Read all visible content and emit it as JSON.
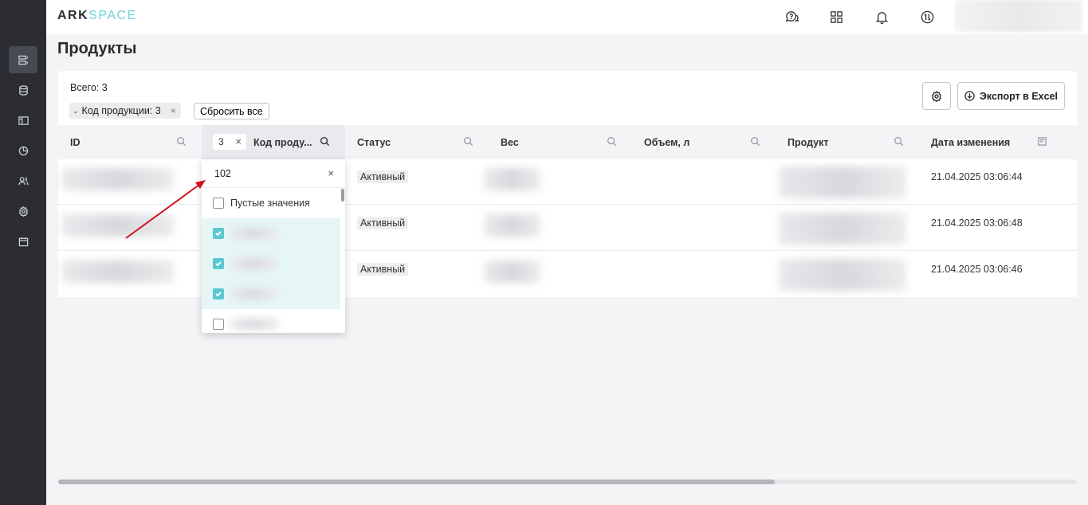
{
  "app": {
    "logo_ark": "ARK",
    "logo_space": "SPACE"
  },
  "sidebar": {
    "items": [
      {
        "icon": "products-icon",
        "active": true
      },
      {
        "icon": "database-icon",
        "active": false
      },
      {
        "icon": "layout-icon",
        "active": false
      },
      {
        "icon": "chart-icon",
        "active": false
      },
      {
        "icon": "users-icon",
        "active": false
      },
      {
        "icon": "gear-icon",
        "active": false
      },
      {
        "icon": "calendar-icon",
        "active": false
      }
    ]
  },
  "header": {
    "icons": [
      "support-chat-icon",
      "apps-grid-icon",
      "bell-icon",
      "sync-icon"
    ]
  },
  "page": {
    "title": "Продукты"
  },
  "toolbar": {
    "total": "Всего: 3",
    "filter_chip": "Код продукции: 3",
    "reset_label": "Сбросить все",
    "export_label": "Экспорт в Excel"
  },
  "table": {
    "columns": {
      "id": "ID",
      "code_badge": "3",
      "code": "Код проду...",
      "status": "Статус",
      "weight": "Вес",
      "volume": "Объем, л",
      "product": "Продукт",
      "modified": "Дата изменения"
    },
    "rows": [
      {
        "status": "Активный",
        "modified": "21.04.2025 03:06:44"
      },
      {
        "status": "Активный",
        "modified": "21.04.2025 03:06:48"
      },
      {
        "status": "Активный",
        "modified": "21.04.2025 03:06:46"
      }
    ]
  },
  "filter_dropdown": {
    "search_value": "102",
    "empty_values_label": "Пустые значения",
    "options_checked": [
      true,
      true,
      true,
      false
    ]
  },
  "colors": {
    "accent": "#5cc7d0",
    "sidebar": "#2b2d33",
    "arrow": "#d0141c"
  }
}
